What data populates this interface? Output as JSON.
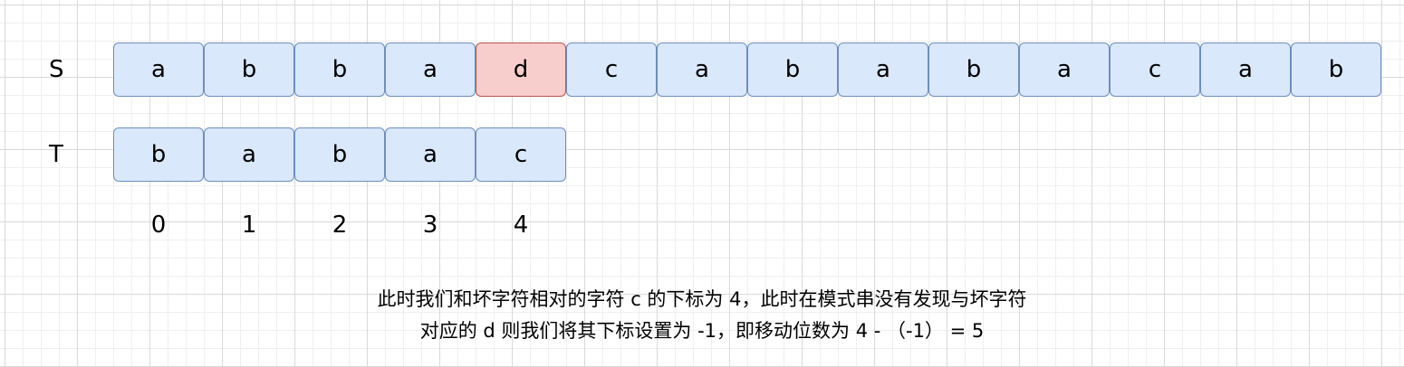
{
  "rows": {
    "s_label": "S",
    "t_label": "T",
    "s_cells": [
      "a",
      "b",
      "b",
      "a",
      "d",
      "c",
      "a",
      "b",
      "a",
      "b",
      "a",
      "c",
      "a",
      "b"
    ],
    "s_highlight_index": 4,
    "t_cells": [
      "b",
      "a",
      "b",
      "a",
      "c"
    ],
    "indices": [
      "0",
      "1",
      "2",
      "3",
      "4"
    ]
  },
  "colors": {
    "cell_fill": "#dae8fc",
    "cell_stroke": "#6c8ebf",
    "highlight_fill": "#f8cecc",
    "highlight_stroke": "#b85450"
  },
  "caption": {
    "line1": "此时我们和坏字符相对的字符 c 的下标为 4，此时在模式串没有发现与坏字符",
    "line2": "对应的 d 则我们将其下标设置为 -1，即移动位数为  4 - （-1） = 5"
  }
}
